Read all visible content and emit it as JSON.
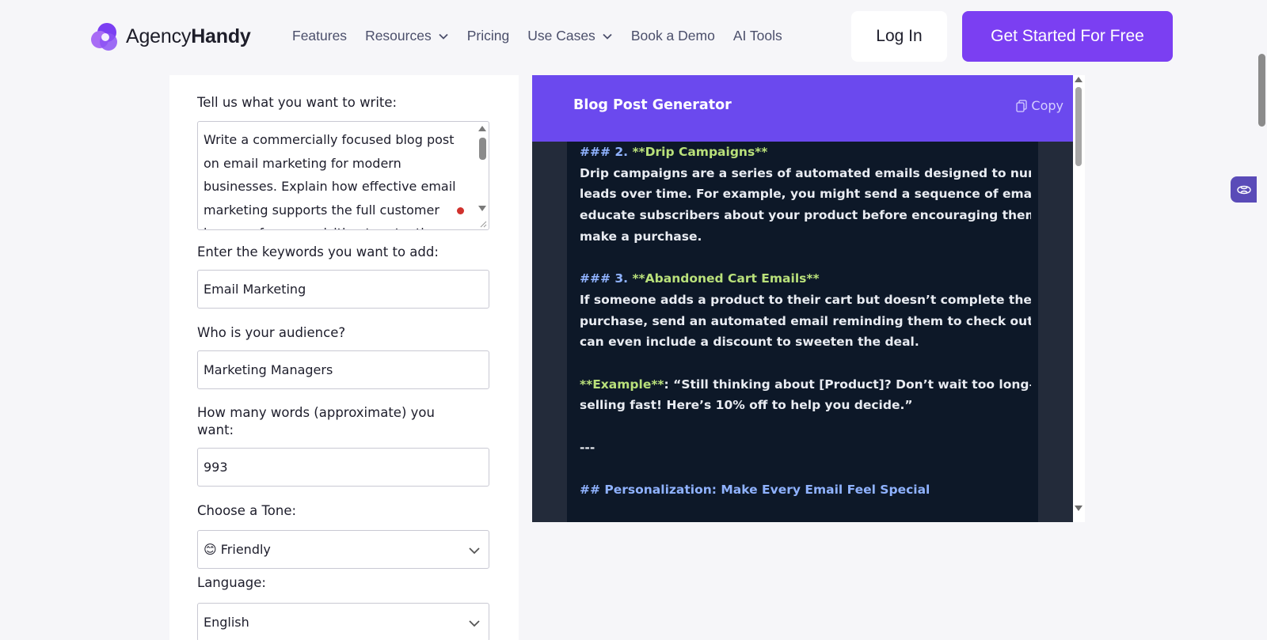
{
  "brand": {
    "name_light": "Agency",
    "name_bold": "Handy"
  },
  "nav": [
    {
      "label": "Features",
      "has_dropdown": false
    },
    {
      "label": "Resources",
      "has_dropdown": true
    },
    {
      "label": "Pricing",
      "has_dropdown": false
    },
    {
      "label": "Use Cases",
      "has_dropdown": true
    },
    {
      "label": "Book a Demo",
      "has_dropdown": false
    },
    {
      "label": "AI Tools",
      "has_dropdown": false
    }
  ],
  "header": {
    "login_label": "Log In",
    "cta_label": "Get Started For Free"
  },
  "form": {
    "prompt_label": "Tell us what you want to write:",
    "prompt_value": "Write a commercially focused blog post on email marketing for modern businesses. Explain how effective email marketing supports the full customer journey, from acquisition to retention",
    "keywords_label": "Enter the keywords you want to add:",
    "keywords_value": "Email Marketing",
    "audience_label": "Who is your audience?",
    "audience_value": "Marketing Managers",
    "words_label": "How many words (approximate) you want:",
    "words_value": "993",
    "tone_label": "Choose a Tone:",
    "tone_value": "😊 Friendly",
    "language_label": "Language:",
    "language_value": "English"
  },
  "generator": {
    "title": "Blog Post Generator",
    "copy_label": "Copy",
    "lines": [
      {
        "text": "### 2. ",
        "extra": "**Drip Campaigns**",
        "style": "heading"
      },
      {
        "text": "Drip campaigns are a series of automated emails designed to nurture",
        "style": "body"
      },
      {
        "text": "leads over time. For example, you might send a sequence of emails that",
        "style": "body"
      },
      {
        "text": "educate subscribers about your product before encouraging them to",
        "style": "body"
      },
      {
        "text": "make a purchase.",
        "style": "body"
      },
      {
        "text": "",
        "style": "blank"
      },
      {
        "text": "### 3. ",
        "extra": "**Abandoned Cart Emails**",
        "style": "heading"
      },
      {
        "text": "If someone adds a product to their cart but doesn’t complete the",
        "style": "body"
      },
      {
        "text": "purchase, send an automated email reminding them to check out. You",
        "style": "body"
      },
      {
        "text": "can even include a discount to sweeten the deal.",
        "style": "body"
      },
      {
        "text": "",
        "style": "blank"
      },
      {
        "text": "**Example**",
        "extra": ": “Still thinking about [Product]? Don’t wait too long—it’s",
        "style": "example"
      },
      {
        "text": "selling fast! Here’s 10% off to help you decide.”",
        "style": "body"
      },
      {
        "text": "",
        "style": "blank"
      },
      {
        "text": "---",
        "style": "body"
      },
      {
        "text": "",
        "style": "blank"
      },
      {
        "text": "## Personalization: Make Every Email Feel Special",
        "style": "h2"
      }
    ]
  },
  "colors": {
    "accent": "#7b3ff2",
    "generator_header": "#6b49ee",
    "editor_bg": "#0d1828",
    "heading_blue": "#8fb2ff",
    "heading_green": "#b9e07a"
  }
}
